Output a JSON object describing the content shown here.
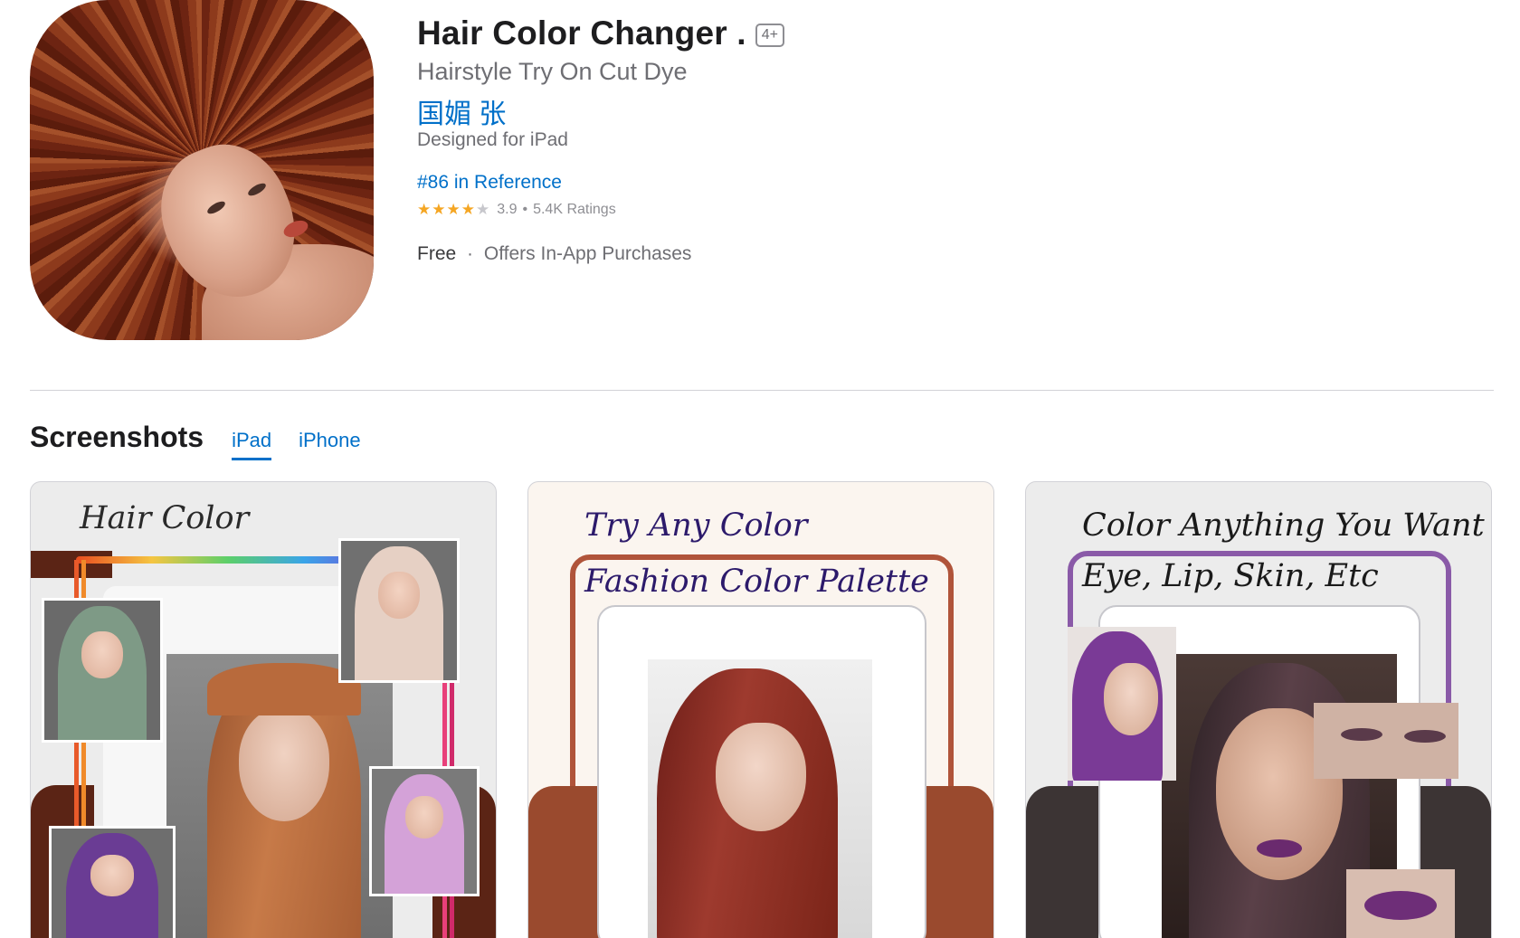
{
  "app": {
    "title": "Hair Color Changer .",
    "age_rating": "4+",
    "subtitle": "Hairstyle Try On Cut Dye",
    "developer": "国媚 张",
    "designed_for": "Designed for iPad",
    "rank": "#86 in Reference",
    "rating": {
      "stars": "★★★★",
      "stars_dim": "★",
      "value": "3.9",
      "separator": "•",
      "count": "5.4K Ratings"
    },
    "price": {
      "free": "Free",
      "separator": "·",
      "iap": "Offers In-App Purchases"
    }
  },
  "screenshots": {
    "title": "Screenshots",
    "tabs": [
      {
        "label": "iPad",
        "active": true
      },
      {
        "label": "iPhone",
        "active": false
      }
    ],
    "items": [
      {
        "captions": [
          "Hair Color"
        ]
      },
      {
        "captions": [
          "Try Any Color",
          "Fashion Color Palette"
        ]
      },
      {
        "captions": [
          "Color Anything You Want",
          "Eye, Lip, Skin, Etc"
        ]
      }
    ]
  },
  "colors": {
    "accent_blue": "#0070c9",
    "star_orange": "#f5a623",
    "caption_purple": "#2c1a6b"
  }
}
